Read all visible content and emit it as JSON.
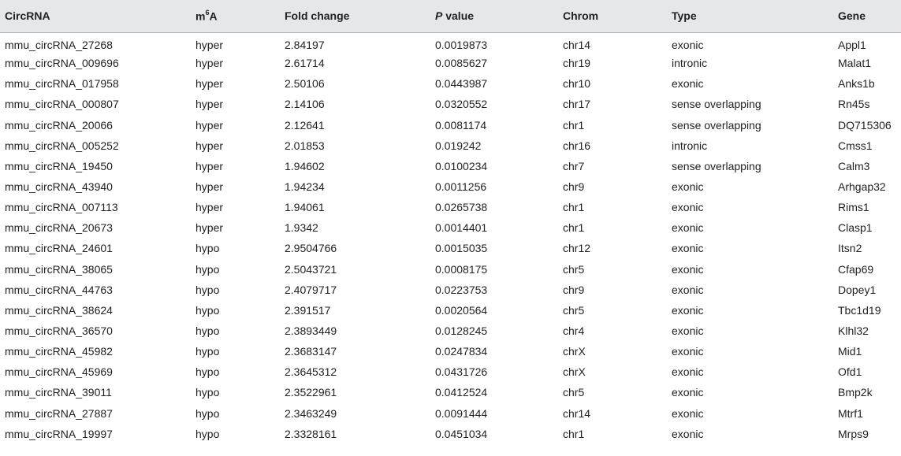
{
  "table": {
    "headers": {
      "circrna": "CircRNA",
      "m6a_base": "m",
      "m6a_sup": "6",
      "m6a_tail": "A",
      "fold_change": "Fold change",
      "p_italic": "P",
      "p_rest": " value",
      "chrom": "Chrom",
      "type": "Type",
      "gene": "Gene"
    },
    "rows": [
      [
        "mmu_circRNA_27268",
        "hyper",
        "2.84197",
        "0.0019873",
        "chr14",
        "exonic",
        "Appl1"
      ],
      [
        "mmu_circRNA_009696",
        "hyper",
        "2.61714",
        "0.0085627",
        "chr19",
        "intronic",
        "Malat1"
      ],
      [
        "mmu_circRNA_017958",
        "hyper",
        "2.50106",
        "0.0443987",
        "chr10",
        "exonic",
        "Anks1b"
      ],
      [
        "mmu_circRNA_000807",
        "hyper",
        "2.14106",
        "0.0320552",
        "chr17",
        "sense overlapping",
        "Rn45s"
      ],
      [
        "mmu_circRNA_20066",
        "hyper",
        "2.12641",
        "0.0081174",
        "chr1",
        "sense overlapping",
        "DQ715306"
      ],
      [
        "mmu_circRNA_005252",
        "hyper",
        "2.01853",
        "0.019242",
        "chr16",
        "intronic",
        "Cmss1"
      ],
      [
        "mmu_circRNA_19450",
        "hyper",
        "1.94602",
        "0.0100234",
        "chr7",
        "sense overlapping",
        "Calm3"
      ],
      [
        "mmu_circRNA_43940",
        "hyper",
        "1.94234",
        "0.0011256",
        "chr9",
        "exonic",
        "Arhgap32"
      ],
      [
        "mmu_circRNA_007113",
        "hyper",
        "1.94061",
        "0.0265738",
        "chr1",
        "exonic",
        "Rims1"
      ],
      [
        "mmu_circRNA_20673",
        "hyper",
        "1.9342",
        "0.0014401",
        "chr1",
        "exonic",
        "Clasp1"
      ],
      [
        "mmu_circRNA_24601",
        "hypo",
        "2.9504766",
        "0.0015035",
        "chr12",
        "exonic",
        "Itsn2"
      ],
      [
        "mmu_circRNA_38065",
        "hypo",
        "2.5043721",
        "0.0008175",
        "chr5",
        "exonic",
        "Cfap69"
      ],
      [
        "mmu_circRNA_44763",
        "hypo",
        "2.4079717",
        "0.0223753",
        "chr9",
        "exonic",
        "Dopey1"
      ],
      [
        "mmu_circRNA_38624",
        "hypo",
        "2.391517",
        "0.0020564",
        "chr5",
        "exonic",
        "Tbc1d19"
      ],
      [
        "mmu_circRNA_36570",
        "hypo",
        "2.3893449",
        "0.0128245",
        "chr4",
        "exonic",
        "Klhl32"
      ],
      [
        "mmu_circRNA_45982",
        "hypo",
        "2.3683147",
        "0.0247834",
        "chrX",
        "exonic",
        "Mid1"
      ],
      [
        "mmu_circRNA_45969",
        "hypo",
        "2.3645312",
        "0.0431726",
        "chrX",
        "exonic",
        "Ofd1"
      ],
      [
        "mmu_circRNA_39011",
        "hypo",
        "2.3522961",
        "0.0412524",
        "chr5",
        "exonic",
        "Bmp2k"
      ],
      [
        "mmu_circRNA_27887",
        "hypo",
        "2.3463249",
        "0.0091444",
        "chr14",
        "exonic",
        "Mtrf1"
      ],
      [
        "mmu_circRNA_19997",
        "hypo",
        "2.3328161",
        "0.0451034",
        "chr1",
        "exonic",
        "Mrps9"
      ]
    ]
  }
}
